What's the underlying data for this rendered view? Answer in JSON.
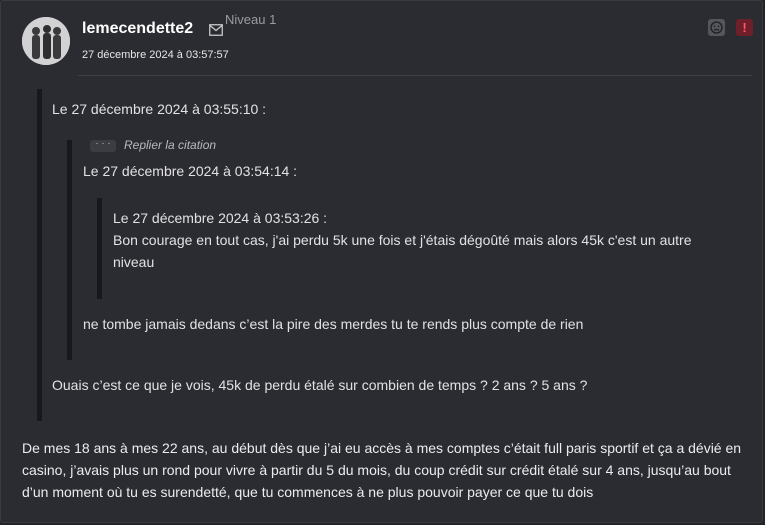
{
  "author": {
    "username": "lemecendette2",
    "level": "Niveau 1",
    "date": "27 décembre 2024 à 03:57:57",
    "icons": [
      "avatar",
      "mail-icon"
    ]
  },
  "actions": {
    "icons": [
      "sad-face-icon",
      "alert-icon"
    ],
    "alert_glyph": "!"
  },
  "quotes": {
    "outer": {
      "header": "Le 27 décembre 2024 à 03:55:10 :",
      "text": "Ouais c’est ce que je vois, 45k de perdu étalé sur combien de temps ? 2 ans ? 5 ans ?"
    },
    "replier": {
      "dots": "· · ·",
      "label": "Replier la citation"
    },
    "middle": {
      "header": "Le 27 décembre 2024 à 03:54:14 :",
      "text": "ne tombe jamais dedans c’est la pire des merdes tu te rends plus compte de rien"
    },
    "inner": {
      "header": "Le 27 décembre 2024 à 03:53:26 :",
      "text": "Bon courage en tout cas, j'ai perdu 5k une fois et j'étais dégoûté mais alors 45k c'est un autre niveau"
    }
  },
  "message": "De mes 18 ans à mes 22 ans, au début dès que j’ai eu accès à mes comptes c’était full paris sportif et ça a dévié en casino, j’avais plus un rond pour vivre à partir du 5 du mois, du coup crédit sur crédit étalé sur 4 ans, jusqu’au bout d’un moment où tu es surendetté, que tu commences à ne plus pouvoir payer ce que tu dois",
  "colors": {
    "background": "#2b2c31",
    "quote_bar": "#17181b",
    "alert": "#6e1f29"
  }
}
